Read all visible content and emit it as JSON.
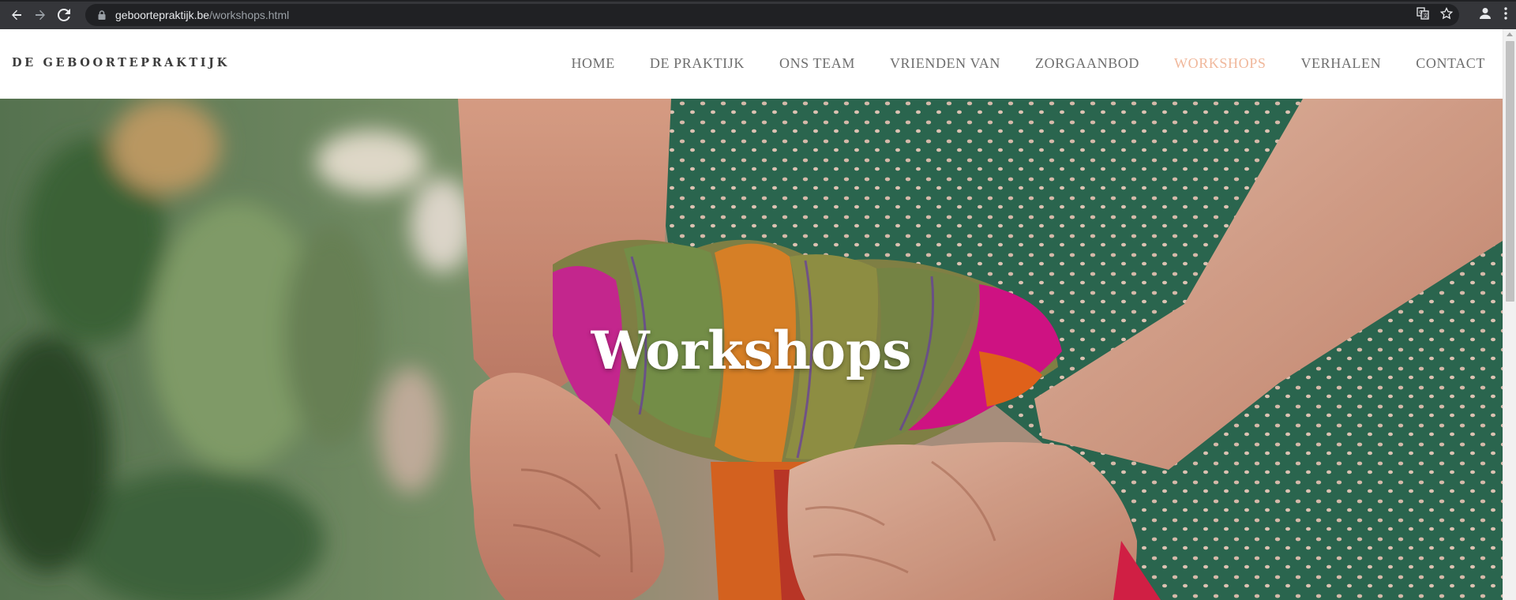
{
  "browser": {
    "url_host": "geboortepraktijk.be",
    "url_path": "/workshops.html",
    "icons": [
      "back-arrow-icon",
      "forward-arrow-icon",
      "reload-icon",
      "lock-icon",
      "translate-icon",
      "star-icon",
      "profile-icon",
      "kebab-menu-icon"
    ]
  },
  "site": {
    "logo": "DE GEBOORTEPRAKTIJK",
    "nav": [
      {
        "label": "HOME",
        "active": false
      },
      {
        "label": "DE PRAKTIJK",
        "active": false
      },
      {
        "label": "ONS TEAM",
        "active": false
      },
      {
        "label": "VRIENDEN VAN",
        "active": false
      },
      {
        "label": "ZORGAANBOD",
        "active": false
      },
      {
        "label": "WORKSHOPS",
        "active": true
      },
      {
        "label": "VERHALEN",
        "active": false
      },
      {
        "label": "CONTACT",
        "active": false
      }
    ],
    "accent_color": "#f0b89c",
    "nav_color": "#6e6e6e"
  },
  "hero": {
    "title": "Workshops",
    "image": "hands-holding-colorful-scarf-photo"
  }
}
